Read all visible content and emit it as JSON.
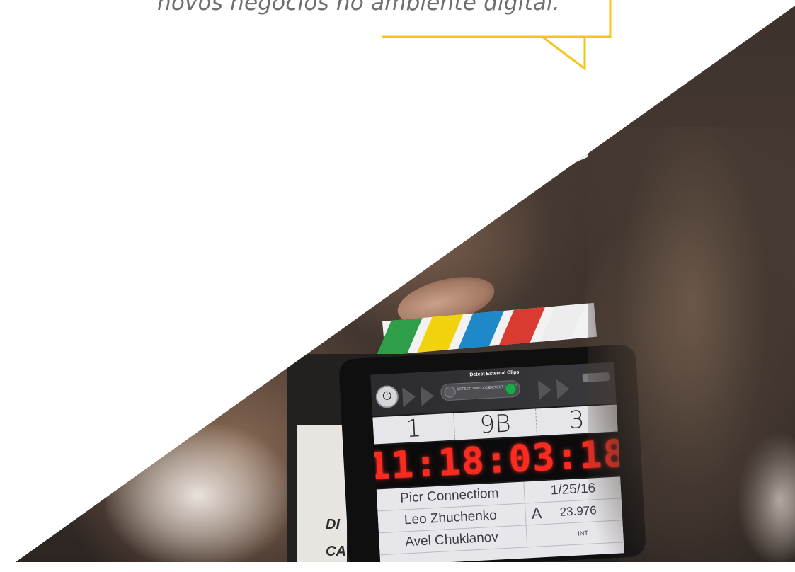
{
  "quote": {
    "text": "novos negócios no ambiente digital."
  },
  "colors": {
    "bubble_stroke": "#f5c518",
    "quote_text": "#6f6f6f",
    "timecode": "#ff2a1f",
    "stripe_green": "#2f9e48",
    "stripe_yellow": "#f0d20f",
    "stripe_blue": "#1f88c9",
    "stripe_red": "#d93a32",
    "record_dot": "#e02b2b"
  },
  "clapper_board": {
    "side_text_1": "DI",
    "side_text_2": "CA"
  },
  "slate_app": {
    "screen_title": "Detect External Clips",
    "toggle_left_label": "DETECT\nTIMECODE",
    "toggle_right_label": "DETECT\nSOUND",
    "roll": "1",
    "scene": "9B",
    "take": "3",
    "timecode": "11:18:03:18",
    "production": "Picr Connectiom",
    "director": "Leo Zhuchenko",
    "camera_operator": "Avel Chuklanov",
    "date": "1/25/16",
    "camera": "A",
    "fps": "23.976",
    "int_ext": "INT"
  }
}
